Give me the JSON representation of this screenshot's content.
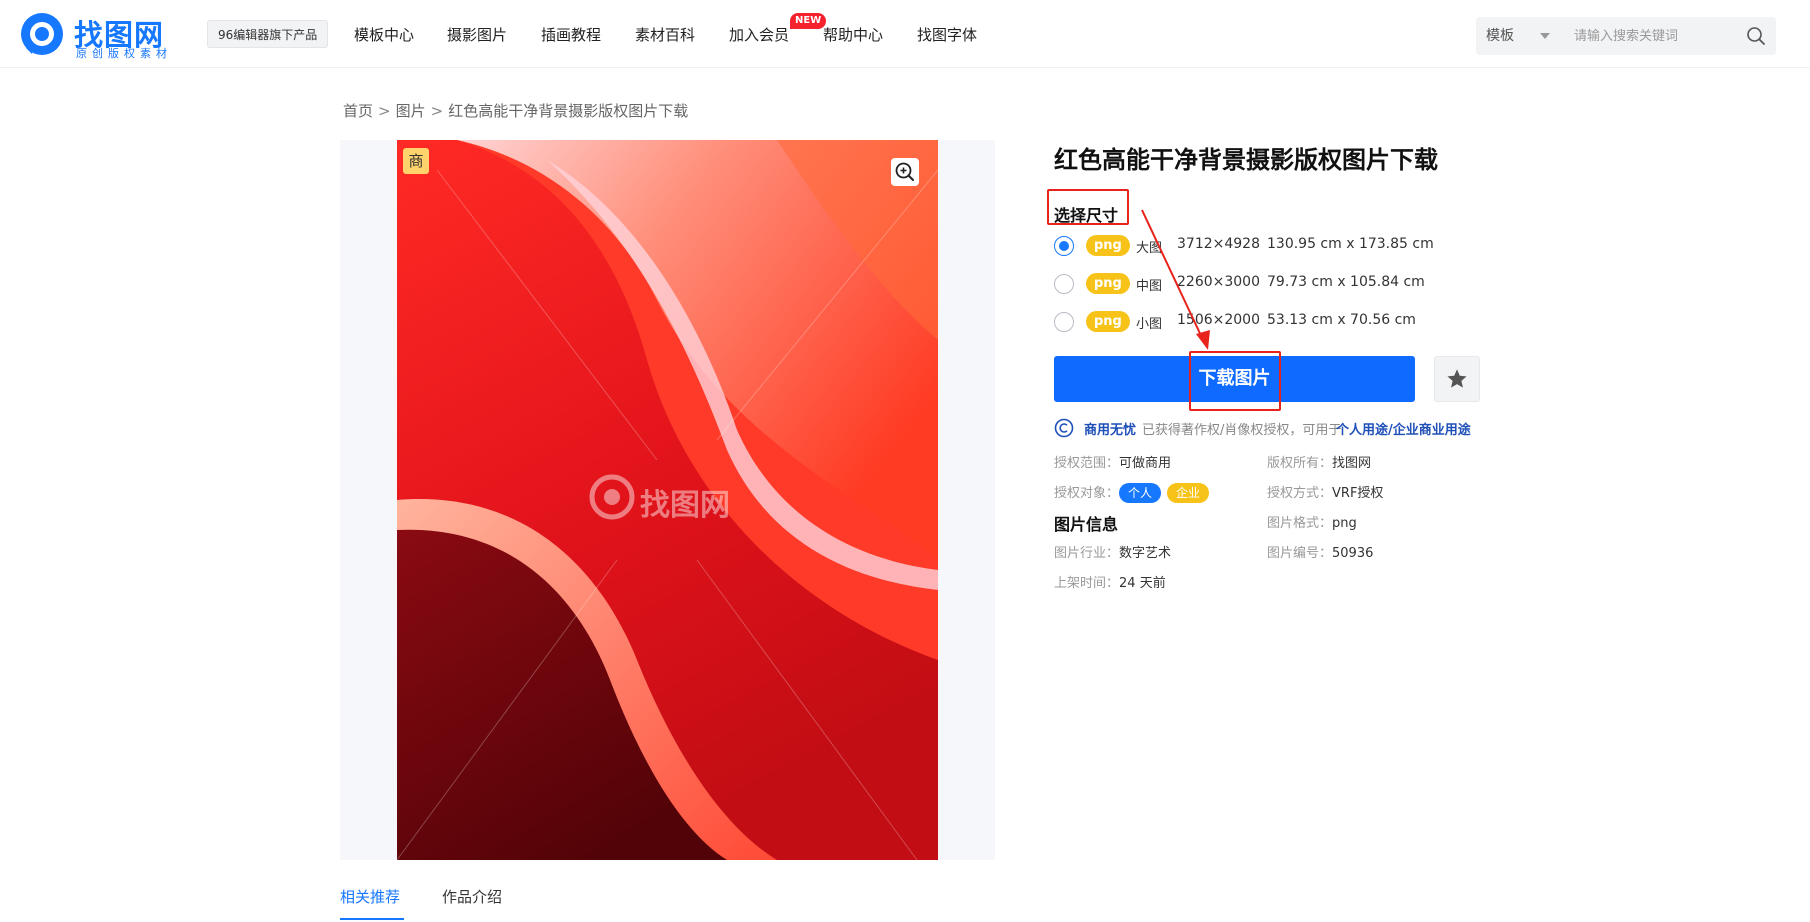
{
  "header": {
    "logo_title": "找图网",
    "logo_sub": "原创版权素材",
    "badge_96": "96编辑器旗下产品",
    "nav": [
      {
        "label": "模板中心"
      },
      {
        "label": "摄影图片"
      },
      {
        "label": "插画教程"
      },
      {
        "label": "素材百科"
      },
      {
        "label": "加入会员"
      },
      {
        "label": "帮助中心"
      },
      {
        "label": "找图字体"
      }
    ],
    "new_tag": "NEW",
    "search": {
      "select_value": "模板",
      "placeholder": "请输入搜索关键词"
    }
  },
  "breadcrumb": [
    "首页",
    "图片",
    "红色高能干净背景摄影版权图片下载"
  ],
  "breadcrumb_sep": ">",
  "preview": {
    "commercial_tag": "商",
    "watermark": "找图网"
  },
  "detail": {
    "title": "红色高能干净背景摄影版权图片下载",
    "select_size_label": "选择尺寸",
    "sizes": [
      {
        "format": "png",
        "label": "大图",
        "px": "3712×4928",
        "cm": "130.95 cm x 173.85 cm",
        "selected": true
      },
      {
        "format": "png",
        "label": "中图",
        "px": "2260×3000",
        "cm": "79.73 cm x 105.84 cm",
        "selected": false
      },
      {
        "format": "png",
        "label": "小图",
        "px": "1506×2000",
        "cm": "53.13 cm x 70.56 cm",
        "selected": false
      }
    ],
    "download_label": "下载图片",
    "license": {
      "strong": "商用无忧",
      "text": "已获得著作权/肖像权授权，可用于",
      "link": "个人用途/企业商业用途"
    },
    "meta": {
      "scope_k": "授权范围：",
      "scope_v": "可做商用",
      "owner_k": "版权所有：",
      "owner_v": "找图网",
      "target_k": "授权对象：",
      "target_personal": "个人",
      "target_enterprise": "企业",
      "method_k": "授权方式：",
      "method_v": "VRF授权",
      "info_heading": "图片信息",
      "format_k": "图片格式：",
      "format_v": "png",
      "industry_k": "图片行业：",
      "industry_v": "数字艺术",
      "id_k": "图片编号：",
      "id_v": "50936",
      "time_k": "上架时间：",
      "time_v": "24 天前"
    }
  },
  "tabs": [
    {
      "label": "相关推荐",
      "active": true
    },
    {
      "label": "作品介绍",
      "active": false
    }
  ],
  "colors": {
    "accent": "#1677ff",
    "download": "#0f6bff",
    "highlight_red": "#e8231c",
    "png_tag": "#f7c318"
  }
}
